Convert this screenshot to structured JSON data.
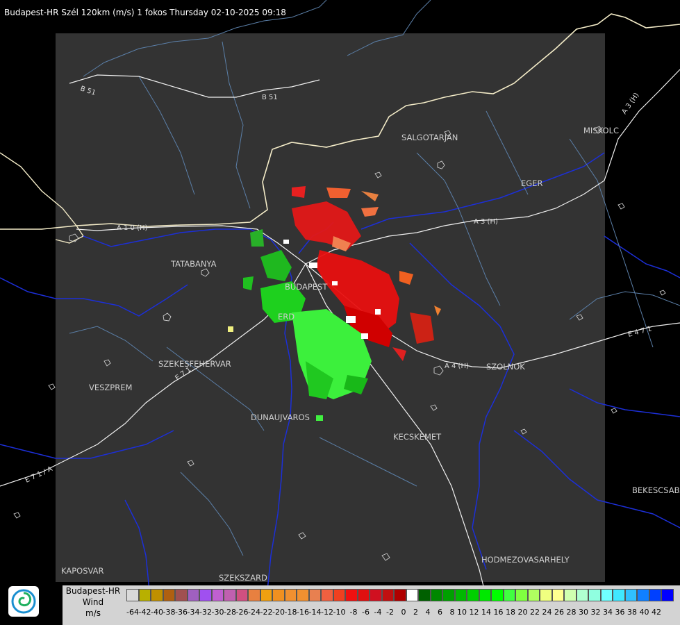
{
  "title": "Budapest-HR Szél 120km (m/s) 1 fokos Thursday 02-10-2025 09:18",
  "places": [
    {
      "id": "salgotarjan",
      "label": "SALGOTARJAN"
    },
    {
      "id": "miskolc",
      "label": "MISKOLC"
    },
    {
      "id": "eger",
      "label": "EGER"
    },
    {
      "id": "tatabanya",
      "label": "TATABANYA"
    },
    {
      "id": "budapest",
      "label": "BUDAPEST"
    },
    {
      "id": "erd",
      "label": "ERD"
    },
    {
      "id": "szekesfehervar",
      "label": "SZEKESFEHERVAR"
    },
    {
      "id": "veszprem",
      "label": "VESZPREM"
    },
    {
      "id": "dunaujvaros",
      "label": "DUNAUJVAROS"
    },
    {
      "id": "kecskemet",
      "label": "KECSKEMET"
    },
    {
      "id": "szolnok",
      "label": "SZOLNOK"
    },
    {
      "id": "bekescsaba",
      "label": "BEKESCSABA"
    },
    {
      "id": "hodmezovasarhely",
      "label": "HODMEZOVASARHELY"
    },
    {
      "id": "kaposvar",
      "label": "KAPOSVAR"
    },
    {
      "id": "szekszard",
      "label": "SZEKSZARD"
    }
  ],
  "roads": [
    {
      "id": "b51-west",
      "label": "B 51"
    },
    {
      "id": "b51-east",
      "label": "B 51"
    },
    {
      "id": "a1",
      "label": "A 1 0 (H)"
    },
    {
      "id": "a3",
      "label": "A 3 (H)"
    },
    {
      "id": "a3-ne",
      "label": "A 3 (H)"
    },
    {
      "id": "a4",
      "label": "A 4 (H)"
    },
    {
      "id": "e471",
      "label": "E 4 7 1"
    },
    {
      "id": "e71",
      "label": "E 7 1"
    },
    {
      "id": "e7x",
      "label": "E 7 1 / A"
    }
  ],
  "legend": {
    "station": "Budapest-HR",
    "quantity": "Wind",
    "unit": "m/s",
    "colors": [
      "#d9d9d9",
      "#b8b000",
      "#c09000",
      "#b06010",
      "#a05050",
      "#a060c0",
      "#a050f0",
      "#c060d0",
      "#c060b0",
      "#d05080",
      "#e88040",
      "#f0a010",
      "#f09020",
      "#f09030",
      "#f09030",
      "#e88050",
      "#f06040",
      "#f04020",
      "#f01010",
      "#e01010",
      "#d01020",
      "#c01010",
      "#b00000",
      "#ffffff",
      "#006000",
      "#008800",
      "#00a000",
      "#00b800",
      "#00d000",
      "#00e800",
      "#00ff00",
      "#40ff40",
      "#80ff40",
      "#b0ff60",
      "#f0ff80",
      "#ffff90",
      "#d0ffb0",
      "#b0ffd0",
      "#90ffe0",
      "#70ffff",
      "#40e8ff",
      "#30c0ff",
      "#1080ff",
      "#0040ff",
      "#0000ff"
    ],
    "ticks": [
      "-64",
      "-42",
      "-40",
      "-38",
      "-36",
      "-34",
      "-32",
      "-30",
      "-28",
      "-26",
      "-24",
      "-22",
      "-20",
      "-18",
      "-16",
      "-14",
      "-12",
      "-10",
      "-8",
      "-6",
      "-4",
      "-2",
      "0",
      "2",
      "4",
      "6",
      "8",
      "10",
      "12",
      "14",
      "16",
      "18",
      "20",
      "22",
      "24",
      "26",
      "28",
      "30",
      "32",
      "34",
      "36",
      "38",
      "40",
      "42"
    ]
  }
}
